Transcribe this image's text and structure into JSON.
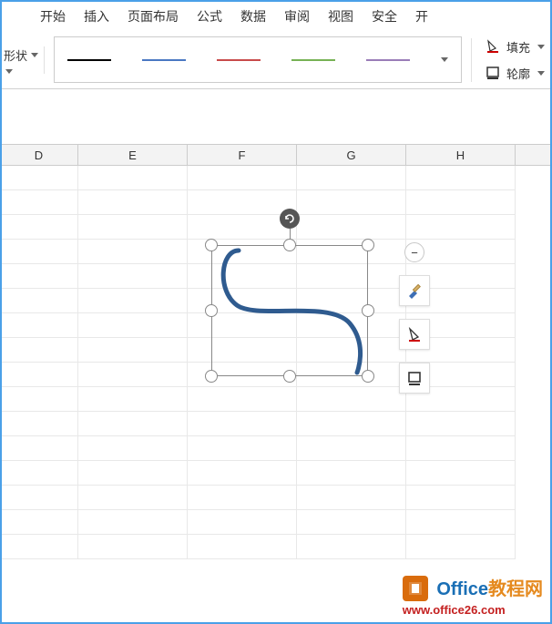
{
  "menu": {
    "items": [
      "开始",
      "插入",
      "页面布局",
      "公式",
      "数据",
      "审阅",
      "视图",
      "安全",
      "开"
    ]
  },
  "ribbon": {
    "shape_label": "形状",
    "line_colors": [
      "#000000",
      "#4a78c2",
      "#c84b4b",
      "#77b255",
      "#9a7db8"
    ],
    "fill_label": "填充",
    "outline_label": "轮廓"
  },
  "columns": [
    "D",
    "E",
    "F",
    "G",
    "H"
  ],
  "floating_tools": {
    "collapse": "−"
  },
  "watermark": {
    "brand_en": "Office",
    "brand_cn": "教程网",
    "url": "www.office26.com"
  },
  "shape": {
    "type": "freeform-curve",
    "selected": true
  }
}
